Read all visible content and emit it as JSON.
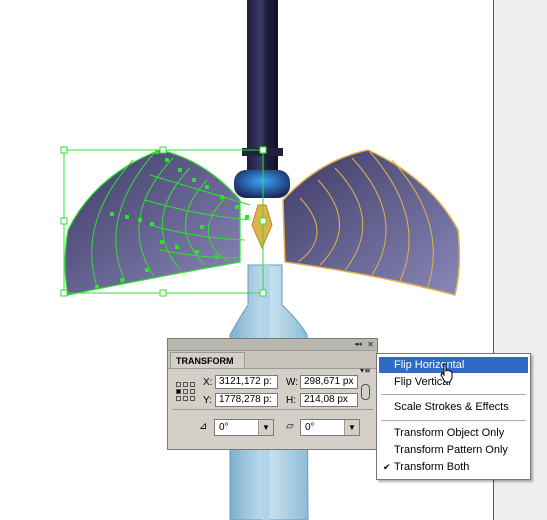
{
  "transform_panel": {
    "tab_label": "TRANSFORM",
    "collapse_icon": "◂◂",
    "close_icon": "✕",
    "menu_icon": "▾≡",
    "x_label": "X:",
    "x_value": "3121,172 p:",
    "y_label": "Y:",
    "y_value": "1778,278 p:",
    "w_label": "W:",
    "w_value": "298,671 px",
    "h_label": "H:",
    "h_value": "214,08 px",
    "rotate_value": "0°",
    "shear_value": "0°",
    "rotate_icon": "⊿",
    "shear_icon": "▱"
  },
  "flyout_menu": {
    "items": [
      {
        "label": "Flip Horizontal",
        "highlighted": true,
        "checked": false
      },
      {
        "label": "Flip Vertical",
        "highlighted": false,
        "checked": false
      },
      {
        "label": "Scale Strokes & Effects",
        "highlighted": false,
        "checked": false
      },
      {
        "label": "Transform Object Only",
        "highlighted": false,
        "checked": false
      },
      {
        "label": "Transform Pattern Only",
        "highlighted": false,
        "checked": false
      },
      {
        "label": "Transform Both",
        "highlighted": false,
        "checked": true
      }
    ],
    "check_mark": "✔"
  },
  "colors": {
    "selection": "#33dd33",
    "highlight": "#316ac5",
    "wing_outline": "#e2b24a",
    "panel_bg": "#d4d0c8"
  }
}
